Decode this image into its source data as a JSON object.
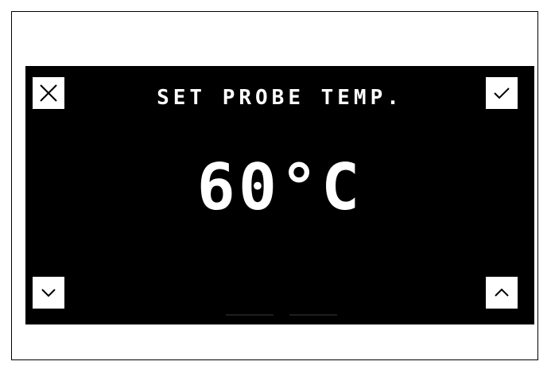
{
  "screen": {
    "title": "SET PROBE TEMP.",
    "value": "60°C"
  },
  "buttons": {
    "cancel": {
      "icon": "close-icon"
    },
    "confirm": {
      "icon": "check-icon"
    },
    "decrease": {
      "icon": "chevron-down-icon"
    },
    "increase": {
      "icon": "chevron-up-icon"
    }
  },
  "colors": {
    "screen_background": "#000000",
    "screen_text": "#ffffff",
    "button_background": "#ffffff",
    "page_background": "#ffffff"
  }
}
